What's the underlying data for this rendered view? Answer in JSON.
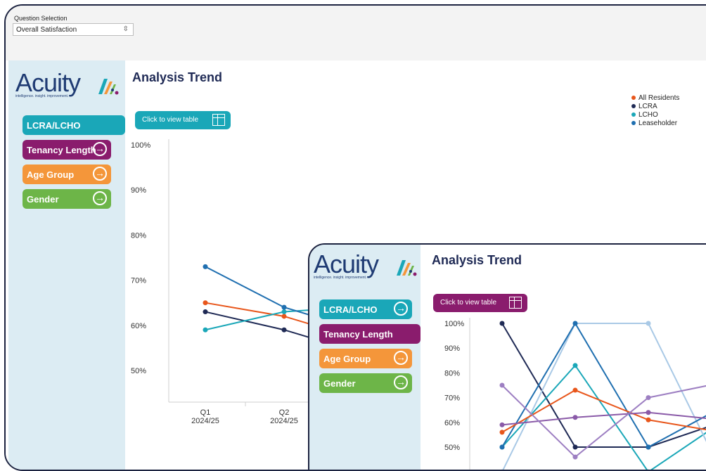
{
  "question_selection": {
    "label": "Question Selection",
    "value": "Overall Satisfaction"
  },
  "main": {
    "logo": {
      "word": "Acuity",
      "tagline": "intelligence. insight. improvement."
    },
    "title": "Analysis Trend",
    "table_button": "Click to view table",
    "nav": [
      {
        "label": "LCRA/LCHO",
        "color": "#1aa7b8"
      },
      {
        "label": "Tenancy Length",
        "color": "#8a1c6d"
      },
      {
        "label": "Age Group",
        "color": "#f4963a"
      },
      {
        "label": "Gender",
        "color": "#6db548"
      }
    ],
    "legend": [
      {
        "label": "All Residents",
        "color": "#e8561b"
      },
      {
        "label": "LCRA",
        "color": "#1f2a55"
      },
      {
        "label": "LCHO",
        "color": "#1aa7b8"
      },
      {
        "label": "Leaseholder",
        "color": "#1f6fb0"
      }
    ]
  },
  "inset": {
    "logo": {
      "word": "Acuity",
      "tagline": "intelligence. insight. improvement."
    },
    "title": "Analysis Trend",
    "table_button": "Click to view table",
    "nav": [
      {
        "label": "LCRA/LCHO",
        "color": "#1aa7b8"
      },
      {
        "label": "Tenancy Length",
        "color": "#8a1c6d"
      },
      {
        "label": "Age Group",
        "color": "#f4963a"
      },
      {
        "label": "Gender",
        "color": "#6db548"
      }
    ]
  },
  "chart_data": [
    {
      "type": "line",
      "ylim": [
        40,
        100
      ],
      "yticks": [
        "100%",
        "90%",
        "80%",
        "70%",
        "60%",
        "50%"
      ],
      "categories": [
        "Q1\n2024/25",
        "Q2\n2024/25"
      ],
      "category_lines": [
        [
          "Q1",
          "2024/25"
        ],
        [
          "Q2",
          "2024/25"
        ]
      ],
      "series": [
        {
          "name": "All Residents",
          "color": "#e8561b",
          "values": [
            65,
            62
          ]
        },
        {
          "name": "LCRA",
          "color": "#1f2a55",
          "values": [
            63,
            59
          ]
        },
        {
          "name": "LCHO",
          "color": "#1aa7b8",
          "values": [
            59,
            63
          ]
        },
        {
          "name": "Leaseholder",
          "color": "#1f6fb0",
          "values": [
            73,
            64
          ]
        }
      ]
    },
    {
      "type": "line",
      "ylim": [
        45,
        100
      ],
      "yticks": [
        "100%",
        "90%",
        "80%",
        "70%",
        "60%",
        "50%"
      ],
      "series": [
        {
          "color": "#1f2a55",
          "values": [
            100,
            50,
            50,
            60
          ]
        },
        {
          "color": "#1aa7b8",
          "values": [
            50,
            83,
            40,
            60
          ]
        },
        {
          "color": "#a9c9e6",
          "values": [
            40,
            100,
            100,
            40
          ]
        },
        {
          "color": "#1f6fb0",
          "values": [
            50,
            100,
            50,
            66
          ]
        },
        {
          "color": "#e8561b",
          "values": [
            56,
            73,
            61,
            56
          ]
        },
        {
          "color": "#8a5aa8",
          "values": [
            59,
            62,
            64,
            61
          ]
        },
        {
          "color": "#9d7fc2",
          "values": [
            75,
            46,
            70,
            76
          ]
        }
      ]
    }
  ]
}
